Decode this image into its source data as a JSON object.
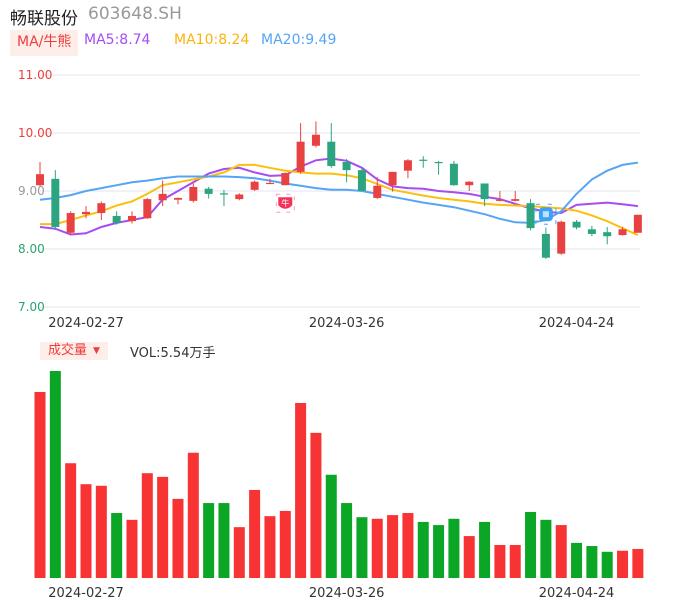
{
  "header": {
    "name": "畅联股份",
    "code": "603648.SH"
  },
  "ma_legend": {
    "button": "MA/牛熊",
    "ma5": "MA5:8.74",
    "ma10": "MA10:8.24",
    "ma20": "MA20:9.49"
  },
  "volume_legend": {
    "button": "成交量",
    "value": "VOL:5.54万手"
  },
  "colors": {
    "up": "#e84142",
    "down": "#2ba47f",
    "vol_up": "#f73333",
    "vol_down": "#0ba626",
    "ma5": "#a64cf0",
    "ma10": "#fbc00e",
    "ma20": "#56a5f5",
    "grid": "#e3e6f0",
    "axis_up": "#f03c3c",
    "axis_flat": "#999999",
    "axis_down": "#2aa36d"
  },
  "chart_data": [
    {
      "type": "candlestick",
      "title": "K线",
      "yticks": [
        "11.00",
        "10.00",
        "9.00",
        "8.00",
        "7.00"
      ],
      "ylim": [
        7,
        11
      ],
      "xlabels": [
        {
          "index": 3,
          "label": "2024-02-27"
        },
        {
          "index": 20,
          "label": "2024-03-26"
        },
        {
          "index": 35,
          "label": "2024-04-24"
        }
      ],
      "ohlc": [
        [
          9.1,
          9.29,
          9.5,
          9.08
        ],
        [
          9.21,
          8.38,
          9.36,
          8.33
        ],
        [
          8.28,
          8.62,
          8.65,
          8.24
        ],
        [
          8.6,
          8.64,
          8.74,
          8.53
        ],
        [
          8.62,
          8.79,
          8.82,
          8.5
        ],
        [
          8.57,
          8.45,
          8.65,
          8.42
        ],
        [
          8.48,
          8.57,
          8.65,
          8.44
        ],
        [
          8.53,
          8.86,
          8.88,
          8.52
        ],
        [
          8.84,
          8.95,
          9.18,
          8.74
        ],
        [
          8.85,
          8.88,
          8.89,
          8.77
        ],
        [
          8.83,
          9.07,
          9.13,
          8.8
        ],
        [
          9.04,
          8.95,
          9.07,
          8.87
        ],
        [
          8.96,
          8.94,
          9.02,
          8.74
        ],
        [
          8.86,
          8.94,
          8.96,
          8.84
        ],
        [
          9.02,
          9.16,
          9.18,
          9.0
        ],
        [
          9.12,
          9.14,
          9.21,
          9.12
        ],
        [
          9.1,
          9.31,
          9.32,
          9.1
        ],
        [
          9.33,
          9.85,
          10.17,
          9.3
        ],
        [
          9.78,
          9.97,
          10.2,
          9.75
        ],
        [
          9.85,
          9.43,
          10.17,
          9.4
        ],
        [
          9.5,
          9.36,
          9.55,
          9.15
        ],
        [
          9.36,
          9.0,
          9.4,
          9.0
        ],
        [
          8.88,
          9.09,
          9.24,
          8.86
        ],
        [
          9.1,
          9.33,
          9.33,
          8.99
        ],
        [
          9.35,
          9.53,
          9.55,
          9.22
        ],
        [
          9.54,
          9.52,
          9.6,
          9.4
        ],
        [
          9.5,
          9.48,
          9.52,
          9.28
        ],
        [
          9.47,
          9.1,
          9.52,
          9.09
        ],
        [
          9.1,
          9.16,
          9.17,
          9.0
        ],
        [
          9.13,
          8.86,
          9.13,
          8.74
        ],
        [
          8.83,
          8.85,
          9.0,
          8.82
        ],
        [
          8.83,
          8.86,
          9.0,
          8.82
        ],
        [
          8.79,
          8.36,
          8.86,
          8.32
        ],
        [
          8.26,
          7.85,
          8.37,
          7.83
        ],
        [
          7.92,
          8.47,
          8.49,
          7.9
        ],
        [
          8.47,
          8.37,
          8.5,
          8.34
        ],
        [
          8.34,
          8.26,
          8.4,
          8.22
        ],
        [
          8.29,
          8.22,
          8.38,
          8.08
        ],
        [
          8.24,
          8.34,
          8.38,
          8.23
        ],
        [
          8.28,
          8.59,
          8.59,
          8.28
        ]
      ],
      "series": [
        {
          "name": "MA5",
          "values": [
            8.38,
            8.35,
            8.25,
            8.27,
            8.38,
            8.45,
            8.5,
            8.55,
            8.85,
            9.0,
            9.15,
            9.3,
            9.38,
            9.4,
            9.32,
            9.26,
            9.27,
            9.42,
            9.53,
            9.56,
            9.52,
            9.4,
            9.2,
            9.08,
            9.05,
            9.04,
            9.0,
            8.98,
            8.95,
            8.9,
            8.86,
            8.78,
            8.7,
            8.64,
            8.62,
            8.76,
            8.78,
            8.8,
            8.77,
            8.74
          ]
        },
        {
          "name": "MA10",
          "values": [
            8.43,
            8.43,
            8.5,
            8.58,
            8.65,
            8.75,
            8.82,
            8.95,
            9.1,
            9.15,
            9.2,
            9.25,
            9.32,
            9.45,
            9.45,
            9.4,
            9.35,
            9.32,
            9.3,
            9.3,
            9.27,
            9.22,
            9.12,
            9.02,
            8.97,
            8.92,
            8.88,
            8.85,
            8.82,
            8.78,
            8.76,
            8.75,
            8.74,
            8.72,
            8.7,
            8.66,
            8.58,
            8.48,
            8.36,
            8.24
          ]
        },
        {
          "name": "MA20",
          "values": [
            8.85,
            8.88,
            8.93,
            9.0,
            9.05,
            9.1,
            9.15,
            9.18,
            9.22,
            9.25,
            9.25,
            9.25,
            9.25,
            9.24,
            9.22,
            9.18,
            9.13,
            9.09,
            9.05,
            9.02,
            9.02,
            9.0,
            8.95,
            8.9,
            8.85,
            8.8,
            8.76,
            8.72,
            8.66,
            8.6,
            8.52,
            8.46,
            8.45,
            8.5,
            8.65,
            8.95,
            9.2,
            9.35,
            9.45,
            9.49
          ]
        }
      ],
      "markers": [
        {
          "index": 16,
          "type": "bull-badge",
          "label": "牛"
        },
        {
          "index": 33,
          "type": "blue-badge"
        }
      ]
    },
    {
      "type": "bar",
      "title": "成交量",
      "unit": "万手",
      "values": [
        35.5,
        39.5,
        21.9,
        17.9,
        17.6,
        12.4,
        11.1,
        20.0,
        19.3,
        15.1,
        23.9,
        14.3,
        14.3,
        9.7,
        16.8,
        11.8,
        12.8,
        33.4,
        27.7,
        19.7,
        14.3,
        11.6,
        11.3,
        12.0,
        12.4,
        10.7,
        10.1,
        11.3,
        8.0,
        10.7,
        6.3,
        6.3,
        12.6,
        11.1,
        10.1,
        6.7,
        6.1,
        5.0,
        5.2,
        5.54
      ],
      "xlabels": [
        {
          "index": 3,
          "label": "2024-02-27"
        },
        {
          "index": 20,
          "label": "2024-03-26"
        },
        {
          "index": 35,
          "label": "2024-04-24"
        }
      ]
    }
  ]
}
